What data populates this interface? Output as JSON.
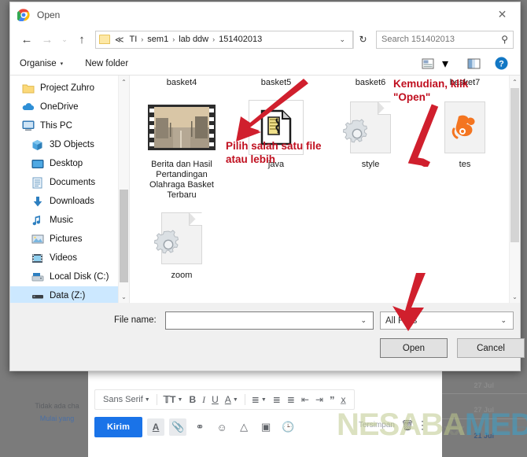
{
  "background": {
    "left_text_line1": "Tidak ada cha",
    "left_text_line2": "Mulai yang",
    "dates": [
      "27 Jul",
      "27 Jul",
      "21 Jul"
    ],
    "watermark": "NESABAMEDIA",
    "watermark_color_a": "#bec88c",
    "watermark_color_b": "#3ca0c8"
  },
  "compose": {
    "font_name": "Sans Serif",
    "toolbar_items": [
      {
        "name": "font-family-select",
        "label": "Sans Serif",
        "caret": true
      },
      {
        "name": "font-size-icon",
        "label": "ＴT",
        "caret": true
      },
      {
        "name": "bold-icon",
        "label": "B",
        "caret": false
      },
      {
        "name": "italic-icon",
        "label": "I",
        "caret": false
      },
      {
        "name": "underline-icon",
        "label": "U",
        "caret": false
      },
      {
        "name": "text-color-icon",
        "label": "A",
        "caret": true
      },
      {
        "name": "align-icon",
        "label": "≡",
        "caret": true
      },
      {
        "name": "numbered-list-icon",
        "label": "≣",
        "caret": false
      },
      {
        "name": "bulleted-list-icon",
        "label": "≣",
        "caret": false
      },
      {
        "name": "indent-less-icon",
        "label": "⇤",
        "caret": false
      },
      {
        "name": "indent-more-icon",
        "label": "⇥",
        "caret": false
      },
      {
        "name": "quote-icon",
        "label": "”",
        "caret": false
      },
      {
        "name": "remove-format-icon",
        "label": "✗",
        "caret": false
      }
    ],
    "send_label": "Kirim",
    "action_icons": [
      {
        "name": "formatting-icon",
        "glyph": "A"
      },
      {
        "name": "attach-file-icon",
        "glyph": "📎"
      },
      {
        "name": "insert-link-icon",
        "glyph": "⚭"
      },
      {
        "name": "insert-emoji-icon",
        "glyph": "☺"
      },
      {
        "name": "insert-drive-icon",
        "glyph": "△"
      },
      {
        "name": "insert-photo-icon",
        "glyph": "▣"
      },
      {
        "name": "confidential-mode-icon",
        "glyph": "🕒"
      }
    ],
    "saved_label": "Tersimpan",
    "trash_glyph": "🗑",
    "more_glyph": "⋮"
  },
  "dialog": {
    "title": "Open",
    "close_label": "✕",
    "nav": {
      "back": "←",
      "forward": "→",
      "recent": "⌄",
      "up": "↑",
      "breadcrumb_prefix": "≪",
      "breadcrumbs": [
        "TI",
        "sem1",
        "lab ddw",
        "151402013"
      ],
      "separator": "›",
      "dropdown_caret": "⌄",
      "refresh": "↻"
    },
    "search": {
      "placeholder": "Search 151402013",
      "value": "",
      "icon": "search-icon"
    },
    "commandbar": {
      "organise_label": "Organise",
      "organise_caret": "▾",
      "new_folder_label": "New folder",
      "view_icon": "view-layout-icon",
      "view_caret": "▾",
      "preview_icon": "preview-pane-icon",
      "help_icon": "help-icon",
      "help_glyph": "?"
    },
    "sidebar": {
      "items": [
        {
          "label": "Project Zuhro",
          "icon": "folder-icon",
          "indent": false,
          "selected": false
        },
        {
          "label": "OneDrive",
          "icon": "cloud-icon",
          "indent": false,
          "selected": false
        },
        {
          "label": "This PC",
          "icon": "monitor-icon",
          "indent": false,
          "selected": false
        },
        {
          "label": "3D Objects",
          "icon": "cube-icon",
          "indent": true,
          "selected": false
        },
        {
          "label": "Desktop",
          "icon": "desktop-icon",
          "indent": true,
          "selected": false
        },
        {
          "label": "Documents",
          "icon": "documents-icon",
          "indent": true,
          "selected": false
        },
        {
          "label": "Downloads",
          "icon": "download-arrow-icon",
          "indent": true,
          "selected": false
        },
        {
          "label": "Music",
          "icon": "music-note-icon",
          "indent": true,
          "selected": false
        },
        {
          "label": "Pictures",
          "icon": "picture-icon",
          "indent": true,
          "selected": false
        },
        {
          "label": "Videos",
          "icon": "video-icon",
          "indent": true,
          "selected": false
        },
        {
          "label": "Local Disk (C:)",
          "icon": "hard-drive-icon",
          "indent": true,
          "selected": false
        },
        {
          "label": "Data (Z:)",
          "icon": "network-drive-icon",
          "indent": true,
          "selected": true
        }
      ],
      "scroll_up": "⌃",
      "scroll_down": "⌄"
    },
    "files": {
      "row1": [
        {
          "label": "basket4",
          "icon": "folder-icon",
          "kind": "folder"
        },
        {
          "label": "basket5",
          "icon": "folder-icon",
          "kind": "folder"
        },
        {
          "label": "basket6",
          "icon": "folder-icon",
          "kind": "folder"
        },
        {
          "label": "basket7",
          "icon": "folder-icon",
          "kind": "folder"
        }
      ],
      "row2": [
        {
          "label": "Berita dan Hasil Pertandingan Olahraga Basket Terbaru",
          "icon": "film-thumbnail-icon",
          "kind": "video"
        },
        {
          "label": "java",
          "icon": "java-file-icon",
          "kind": "java"
        },
        {
          "label": "style",
          "icon": "gear-document-icon",
          "kind": "css"
        },
        {
          "label": "tes",
          "icon": "uc-browser-file-icon",
          "kind": "uc"
        }
      ],
      "row3": [
        {
          "label": "zoom",
          "icon": "gear-document-icon",
          "kind": "css"
        }
      ]
    },
    "annotations": [
      {
        "name": "annotation-select-file",
        "text": "Pilih salah satu file\natau lebih",
        "color": "#c00f1f"
      },
      {
        "name": "annotation-click-open",
        "text": "Kemudian, klik\n\"Open\"",
        "color": "#c00f1f"
      }
    ],
    "footer": {
      "filename_label": "File name:",
      "filename_value": "",
      "filename_caret": "⌄",
      "filetype_value": "All Files",
      "filetype_caret": "⌄",
      "open_label": "Open",
      "cancel_label": "Cancel"
    }
  }
}
